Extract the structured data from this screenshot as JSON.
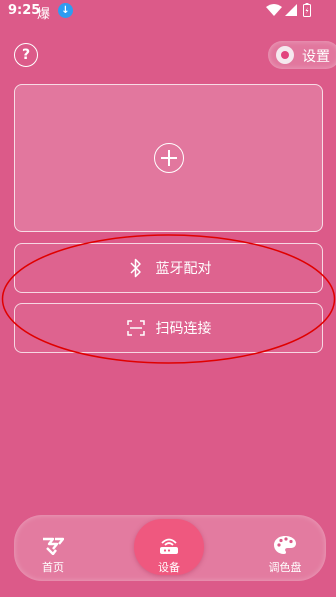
{
  "status_bar": {
    "time": "9:25",
    "glyph": "爆",
    "icons": [
      "download-icon",
      "wifi-icon",
      "signal-icon",
      "battery-icon"
    ]
  },
  "top": {
    "help_icon": "question-circle-icon",
    "settings_label": "设置"
  },
  "cards": {
    "add_icon": "plus-circle-icon",
    "bluetooth_label": "蓝牙配对",
    "scan_label": "扫码连接"
  },
  "bottom_nav": {
    "items": [
      {
        "label": "首页",
        "icon": "home-logo-icon"
      },
      {
        "label": "设备",
        "icon": "device-icon",
        "active": true
      },
      {
        "label": "调色盘",
        "icon": "palette-icon"
      }
    ]
  },
  "colors": {
    "background": "#dc5a89",
    "active_tab": "#ef587f",
    "annotation": "#e00000"
  }
}
